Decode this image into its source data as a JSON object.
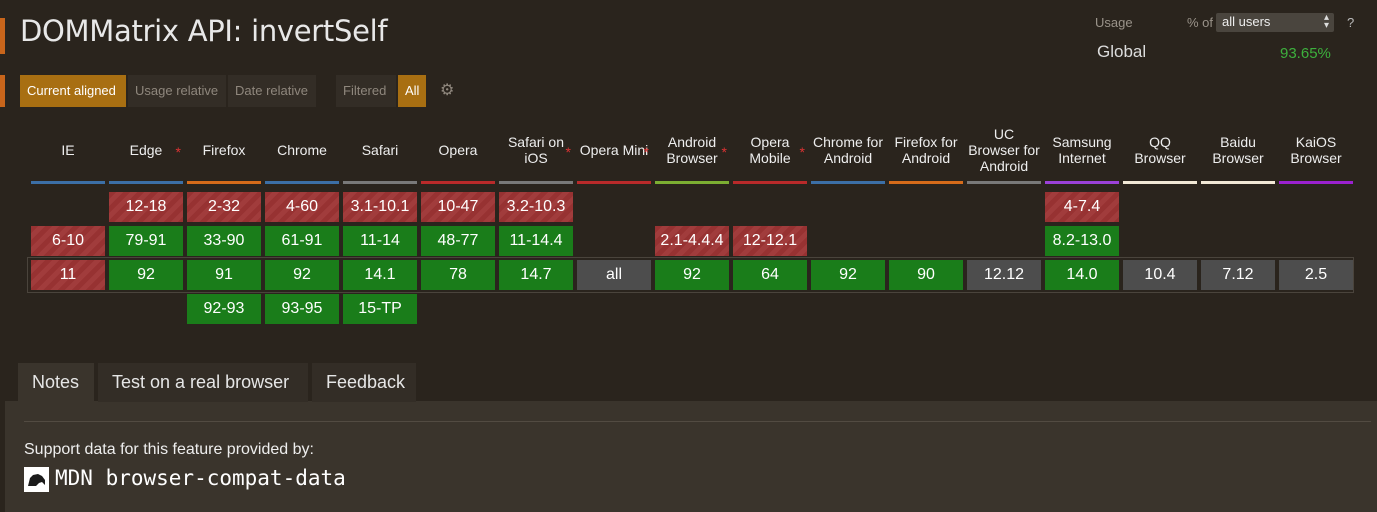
{
  "title": "DOMMatrix API: invertSelf",
  "usage": {
    "label": "Usage",
    "pct_of": "% of",
    "selected": "all users",
    "help": "?",
    "scope": "Global",
    "value": "93.65%"
  },
  "view_modes": [
    "Current aligned",
    "Usage relative",
    "Date relative"
  ],
  "filters": [
    "Filtered",
    "All"
  ],
  "browsers": [
    {
      "name": "IE",
      "color": "#3c6fa6"
    },
    {
      "name": "Edge",
      "color": "#3c6fa6"
    },
    {
      "name": "Firefox",
      "color": "#d56b1a"
    },
    {
      "name": "Chrome",
      "color": "#3c6fa6"
    },
    {
      "name": "Safari",
      "color": "#797979"
    },
    {
      "name": "Opera",
      "color": "#b92a2a"
    },
    {
      "name": "Safari on iOS",
      "color": "#797979"
    },
    {
      "name": "Opera Mini",
      "color": "#b92a2a"
    },
    {
      "name": "Android Browser",
      "color": "#7cae32"
    },
    {
      "name": "Opera Mobile",
      "color": "#b92a2a"
    },
    {
      "name": "Chrome for Android",
      "color": "#3c6fa6"
    },
    {
      "name": "Firefox for Android",
      "color": "#d56b1a"
    },
    {
      "name": "UC Browser for Android",
      "color": "#797979"
    },
    {
      "name": "Samsung Internet",
      "color": "#9b41d8"
    },
    {
      "name": "QQ Browser",
      "color": "#f1e8d6"
    },
    {
      "name": "Baidu Browser",
      "color": "#f1e8d6"
    },
    {
      "name": "KaiOS Browser",
      "color": "#9b21cf"
    }
  ],
  "notes_star": "*",
  "support_rows": {
    "row1": [
      "",
      "12-18",
      "2-32",
      "4-60",
      "3.1-10.1",
      "10-47",
      "3.2-10.3",
      "",
      "",
      "",
      "",
      "",
      "",
      "4-7.4",
      "",
      "",
      ""
    ],
    "row2": [
      "6-10",
      "79-91",
      "33-90",
      "61-91",
      "11-14",
      "48-77",
      "11-14.4",
      "",
      "2.1-4.4.4",
      "12-12.1",
      "",
      "",
      "",
      "8.2-13.0",
      "",
      "",
      ""
    ],
    "current": [
      "11",
      "92",
      "91",
      "92",
      "14.1",
      "78",
      "14.7",
      "all",
      "92",
      "64",
      "92",
      "90",
      "12.12",
      "14.0",
      "10.4",
      "7.12",
      "2.5"
    ],
    "future": [
      "",
      "",
      "92-93",
      "93-95",
      "15-TP",
      "",
      "",
      "",
      "",
      "",
      "",
      "",
      "",
      "",
      "",
      "",
      ""
    ]
  },
  "tabs": [
    "Notes",
    "Test on a real browser",
    "Feedback"
  ],
  "support_text": "Support data for this feature provided by:",
  "mdn_label": "MDN browser-compat-data"
}
